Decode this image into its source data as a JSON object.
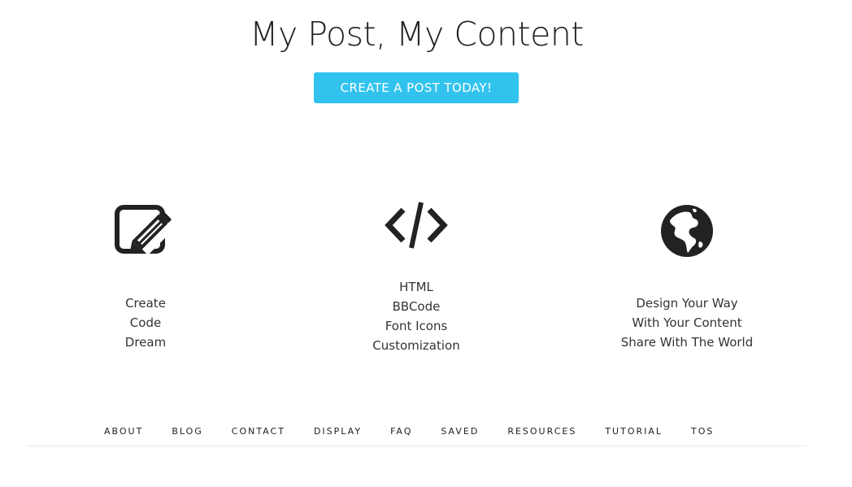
{
  "hero": {
    "title": "My Post, My Content",
    "cta_label": "CREATE A POST TODAY!"
  },
  "features": [
    {
      "icon": "edit-icon",
      "lines": [
        "Create",
        "Code",
        "Dream"
      ]
    },
    {
      "icon": "code-icon",
      "lines": [
        "HTML",
        "BBCode",
        "Font Icons",
        "Customization"
      ]
    },
    {
      "icon": "globe-icon",
      "lines": [
        "Design Your Way",
        "With Your Content",
        "Share With The World"
      ]
    }
  ],
  "footer": {
    "links": [
      "ABOUT",
      "BLOG",
      "CONTACT",
      "DISPLAY",
      "FAQ",
      "SAVED",
      "RESOURCES",
      "TUTORIAL",
      "TOS"
    ]
  },
  "colors": {
    "accent": "#31c3ee",
    "text": "#222222",
    "background": "#ffffff"
  }
}
